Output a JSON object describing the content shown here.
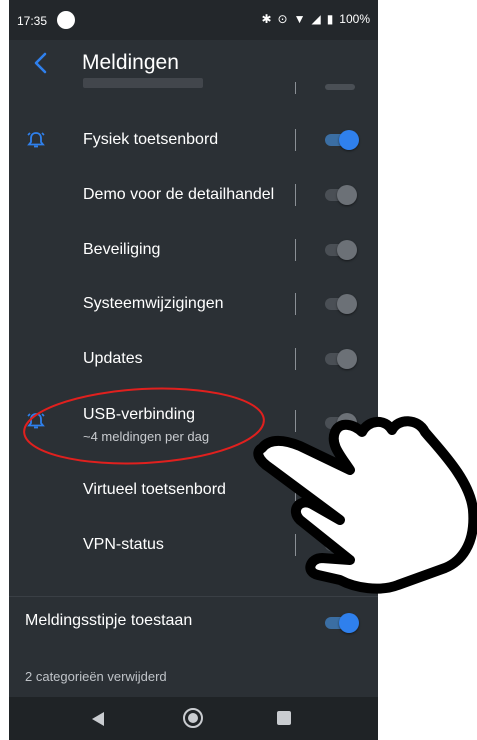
{
  "status_bar": {
    "time": "17:35",
    "battery": "100%"
  },
  "app_bar": {
    "title": "Meldingen"
  },
  "rows": [
    {
      "label": "Fysiek toetsenbord",
      "subtitle": "",
      "toggle": "on",
      "bell": true
    },
    {
      "label": "Demo voor de detailhandel",
      "subtitle": "",
      "toggle": "off",
      "bell": false
    },
    {
      "label": "Beveiliging",
      "subtitle": "",
      "toggle": "off",
      "bell": false
    },
    {
      "label": "Systeemwijzigingen",
      "subtitle": "",
      "toggle": "off",
      "bell": false
    },
    {
      "label": "Updates",
      "subtitle": "",
      "toggle": "off",
      "bell": false
    },
    {
      "label": "USB-verbinding",
      "subtitle": "~4 meldingen per dag",
      "toggle": "off",
      "bell": true
    },
    {
      "label": "Virtueel toetsenbord",
      "subtitle": "",
      "toggle": "on",
      "bell": false
    },
    {
      "label": "VPN-status",
      "subtitle": "",
      "toggle": "off",
      "bell": false
    }
  ],
  "setting_dot": {
    "label": "Meldingsstipje toestaan",
    "toggle": "on"
  },
  "footer": {
    "text": "2 categorieën verwijderd"
  },
  "colors": {
    "accent": "#2f80ed",
    "background": "#2b3035",
    "annotation": "#e0201e"
  }
}
